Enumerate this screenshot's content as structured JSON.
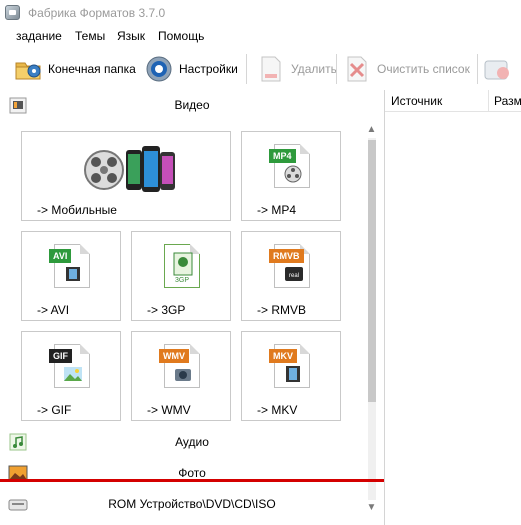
{
  "window": {
    "title": "Фабрика Форматов 3.7.0"
  },
  "menu": {
    "items": [
      "задание",
      "Темы",
      "Язык",
      "Помощь"
    ]
  },
  "toolbar": {
    "output_folder_label": "Конечная папка",
    "settings_label": "Настройки",
    "delete_label": "Удалить",
    "clear_list_label": "Очистить список"
  },
  "categories": {
    "video_label": "Видео",
    "audio_label": "Аудио",
    "photo_label": "Фото",
    "rom_label": "ROM Устройство\\DVD\\CD\\ISO"
  },
  "tiles": {
    "mobile": {
      "label": "-> Мобильные"
    },
    "mp4": {
      "label": "-> MP4",
      "tag": "MP4"
    },
    "avi": {
      "label": "-> AVI",
      "tag": "AVI"
    },
    "3gp": {
      "label": "-> 3GP",
      "tag": "3GP"
    },
    "rmvb": {
      "label": "-> RMVB",
      "tag": "RMVB"
    },
    "gif": {
      "label": "-> GIF",
      "tag": "GIF"
    },
    "wmv": {
      "label": "-> WMV",
      "tag": "WMV"
    },
    "mkv": {
      "label": "-> MKV",
      "tag": "MKV"
    }
  },
  "file_list": {
    "columns": [
      "Источник",
      "Разме"
    ]
  },
  "colors": {
    "accent_red": "#d40000",
    "tag_green": "#2e9a3c",
    "tag_orange": "#e07a1e"
  }
}
